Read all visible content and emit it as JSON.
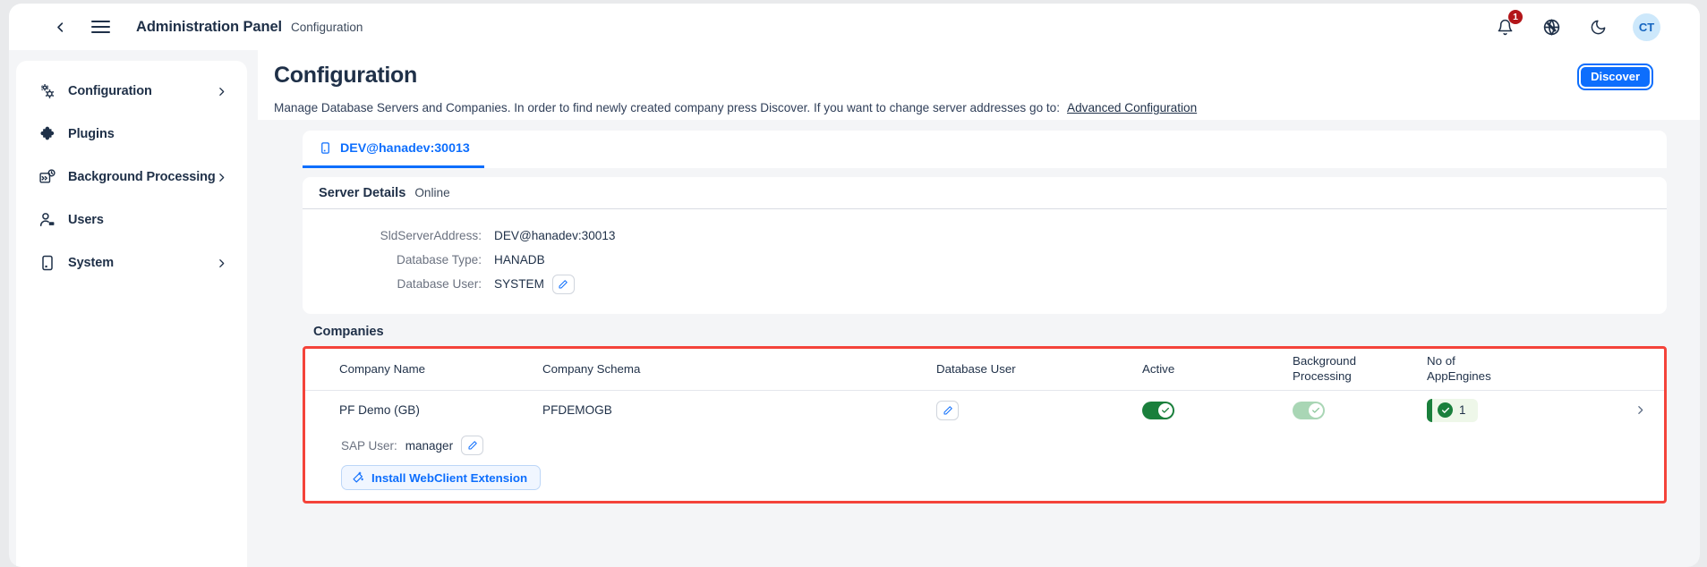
{
  "topbar": {
    "back_icon": "chevron-left-icon",
    "menu_icon": "hamburger-menu-icon",
    "app_title": "Administration Panel",
    "breadcrumb": "Configuration",
    "notifications_icon": "bell-icon",
    "notifications_count": "1",
    "language_icon": "globe-icon",
    "theme_icon": "moon-icon",
    "avatar_initials": "CT"
  },
  "sidebar": {
    "items": [
      {
        "label": "Configuration",
        "icon": "gears-icon",
        "has_caret": true
      },
      {
        "label": "Plugins",
        "icon": "puzzle-piece-icon",
        "has_caret": false
      },
      {
        "label": "Background Processing",
        "icon": "background-tasks-icon",
        "has_caret": true
      },
      {
        "label": "Users",
        "icon": "user-icon",
        "has_caret": false
      },
      {
        "label": "System",
        "icon": "device-icon",
        "has_caret": true
      }
    ]
  },
  "page": {
    "title": "Configuration",
    "description": "Manage Database Servers and Companies. In order to find newly created company press Discover. If you want to change server addresses go to:",
    "advanced_link": "Advanced Configuration",
    "discover_button": "Discover"
  },
  "tabs": [
    {
      "label": "DEV@hanadev:30013",
      "icon": "server-icon",
      "active": true
    }
  ],
  "server_details": {
    "heading": "Server Details",
    "status": "Online",
    "rows": [
      {
        "label": "SldServerAddress:",
        "value": "DEV@hanadev:30013",
        "editable": false
      },
      {
        "label": "Database Type:",
        "value": "HANADB",
        "editable": false
      },
      {
        "label": "Database User:",
        "value": "SYSTEM",
        "editable": true
      }
    ]
  },
  "companies": {
    "title": "Companies",
    "columns": [
      "Company Name",
      "Company Schema",
      "Database User",
      "Active",
      "Background\nProcessing",
      "No of\nAppEngines"
    ],
    "col_company_name": "Company Name",
    "col_company_schema": "Company Schema",
    "col_database_user": "Database User",
    "col_active": "Active",
    "col_background_processing_l1": "Background",
    "col_background_processing_l2": "Processing",
    "col_appengines_l1": "No of",
    "col_appengines_l2": "AppEngines",
    "row": {
      "company_name": "PF Demo (GB)",
      "company_schema": "PFDEMOGB",
      "database_user_edit_icon": "pencil-icon",
      "active": true,
      "background_processing": true,
      "background_processing_disabled": true,
      "appengines_count": "1",
      "expand_icon": "chevron-right-icon"
    },
    "sap_user_label": "SAP User:",
    "sap_user_value": "manager",
    "sap_user_edit_icon": "pencil-icon",
    "install_button": "Install WebClient Extension",
    "install_button_icon": "magic-wand-icon",
    "highlight_color": "#f4433a"
  },
  "colors": {
    "accent": "#0d6efd",
    "text": "#1f3048",
    "muted": "#6b7280",
    "toggle_on": "#1a7f3c",
    "toggle_dim": "#a9d6b5",
    "badge_red": "#b3161a"
  }
}
